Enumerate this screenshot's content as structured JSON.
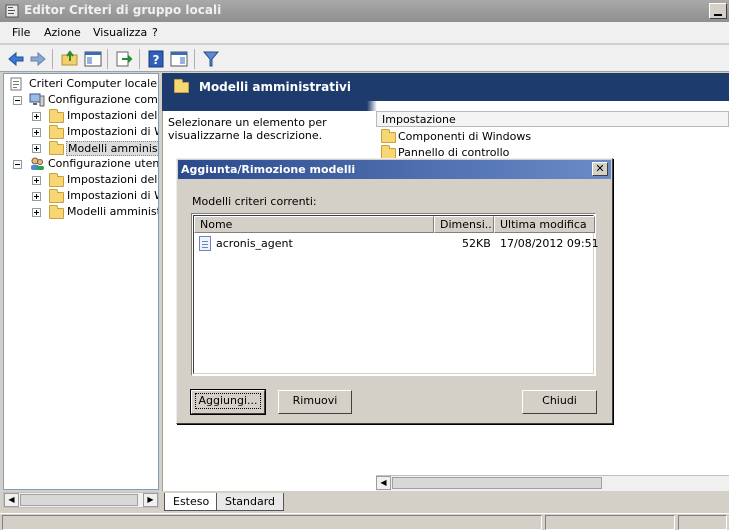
{
  "window": {
    "title": "Editor Criteri di gruppo locali"
  },
  "menu": [
    "File",
    "Azione",
    "Visualizza",
    "?"
  ],
  "toolbar": {
    "icons": [
      "back-arrow-icon",
      "forward-arrow-icon",
      "up-folder-icon",
      "show-hide-tree-icon",
      "export-list-icon",
      "help-icon",
      "properties-view-icon",
      "filter-icon"
    ]
  },
  "tree": {
    "root": "Criteri Computer locale",
    "items": [
      {
        "label": "Configurazione comput",
        "level": 1,
        "expanded": true,
        "icon": "computer-icon"
      },
      {
        "label": "Impostazioni del so",
        "level": 2,
        "icon": "folder-icon"
      },
      {
        "label": "Impostazioni di Wir",
        "level": 2,
        "icon": "folder-icon"
      },
      {
        "label": "Modelli amministrat",
        "level": 2,
        "icon": "folder-icon",
        "selected": true
      },
      {
        "label": "Configurazione utente",
        "level": 1,
        "expanded": true,
        "icon": "users-icon"
      },
      {
        "label": "Impostazioni del so",
        "level": 2,
        "icon": "folder-icon"
      },
      {
        "label": "Impostazioni di Wir",
        "level": 2,
        "icon": "folder-icon"
      },
      {
        "label": "Modelli amministrat",
        "level": 2,
        "icon": "folder-icon"
      }
    ]
  },
  "right_pane": {
    "header": "Modelli amministrativi",
    "description": "Selezionare un elemento per visualizzarne la descrizione.",
    "column": "Impostazione",
    "items": [
      "Componenti di Windows",
      "Pannello di controllo"
    ]
  },
  "tabs": [
    "Esteso",
    "Standard"
  ],
  "dialog": {
    "title": "Aggiunta/Rimozione modelli",
    "close_glyph": "✕",
    "label": "Modelli criteri correnti:",
    "columns": [
      "Nome",
      "Dimensi...",
      "Ultima modifica"
    ],
    "rows": [
      {
        "name": "acronis_agent",
        "size": "52KB",
        "modified": "17/08/2012 09:51"
      }
    ],
    "buttons": {
      "add": "Aggiungi...",
      "remove": "Rimuovi",
      "close": "Chiudi"
    }
  },
  "colors": {
    "header_blue": "#1e3b6e",
    "dialog_title_start": "#2a4a8c",
    "dialog_title_end": "#6a8bc8"
  }
}
